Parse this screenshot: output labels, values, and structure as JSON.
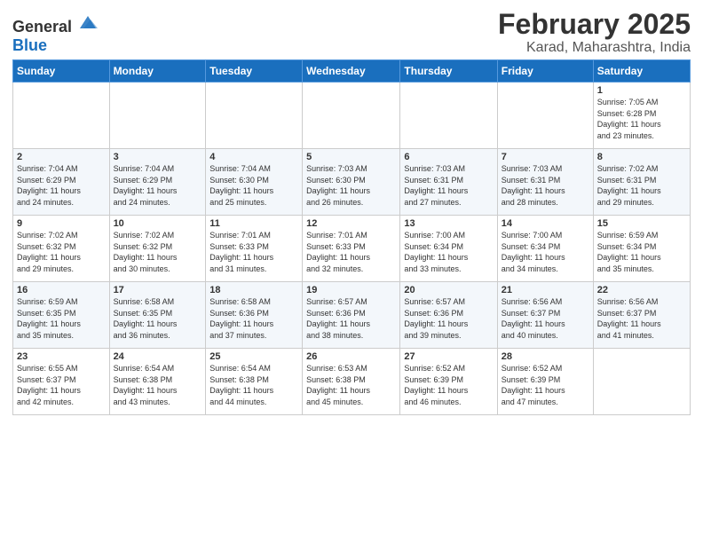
{
  "header": {
    "logo_general": "General",
    "logo_blue": "Blue",
    "month": "February 2025",
    "location": "Karad, Maharashtra, India"
  },
  "days_of_week": [
    "Sunday",
    "Monday",
    "Tuesday",
    "Wednesday",
    "Thursday",
    "Friday",
    "Saturday"
  ],
  "weeks": [
    [
      {
        "num": "",
        "info": ""
      },
      {
        "num": "",
        "info": ""
      },
      {
        "num": "",
        "info": ""
      },
      {
        "num": "",
        "info": ""
      },
      {
        "num": "",
        "info": ""
      },
      {
        "num": "",
        "info": ""
      },
      {
        "num": "1",
        "info": "Sunrise: 7:05 AM\nSunset: 6:28 PM\nDaylight: 11 hours\nand 23 minutes."
      }
    ],
    [
      {
        "num": "2",
        "info": "Sunrise: 7:04 AM\nSunset: 6:29 PM\nDaylight: 11 hours\nand 24 minutes."
      },
      {
        "num": "3",
        "info": "Sunrise: 7:04 AM\nSunset: 6:29 PM\nDaylight: 11 hours\nand 24 minutes."
      },
      {
        "num": "4",
        "info": "Sunrise: 7:04 AM\nSunset: 6:30 PM\nDaylight: 11 hours\nand 25 minutes."
      },
      {
        "num": "5",
        "info": "Sunrise: 7:03 AM\nSunset: 6:30 PM\nDaylight: 11 hours\nand 26 minutes."
      },
      {
        "num": "6",
        "info": "Sunrise: 7:03 AM\nSunset: 6:31 PM\nDaylight: 11 hours\nand 27 minutes."
      },
      {
        "num": "7",
        "info": "Sunrise: 7:03 AM\nSunset: 6:31 PM\nDaylight: 11 hours\nand 28 minutes."
      },
      {
        "num": "8",
        "info": "Sunrise: 7:02 AM\nSunset: 6:31 PM\nDaylight: 11 hours\nand 29 minutes."
      }
    ],
    [
      {
        "num": "9",
        "info": "Sunrise: 7:02 AM\nSunset: 6:32 PM\nDaylight: 11 hours\nand 29 minutes."
      },
      {
        "num": "10",
        "info": "Sunrise: 7:02 AM\nSunset: 6:32 PM\nDaylight: 11 hours\nand 30 minutes."
      },
      {
        "num": "11",
        "info": "Sunrise: 7:01 AM\nSunset: 6:33 PM\nDaylight: 11 hours\nand 31 minutes."
      },
      {
        "num": "12",
        "info": "Sunrise: 7:01 AM\nSunset: 6:33 PM\nDaylight: 11 hours\nand 32 minutes."
      },
      {
        "num": "13",
        "info": "Sunrise: 7:00 AM\nSunset: 6:34 PM\nDaylight: 11 hours\nand 33 minutes."
      },
      {
        "num": "14",
        "info": "Sunrise: 7:00 AM\nSunset: 6:34 PM\nDaylight: 11 hours\nand 34 minutes."
      },
      {
        "num": "15",
        "info": "Sunrise: 6:59 AM\nSunset: 6:34 PM\nDaylight: 11 hours\nand 35 minutes."
      }
    ],
    [
      {
        "num": "16",
        "info": "Sunrise: 6:59 AM\nSunset: 6:35 PM\nDaylight: 11 hours\nand 35 minutes."
      },
      {
        "num": "17",
        "info": "Sunrise: 6:58 AM\nSunset: 6:35 PM\nDaylight: 11 hours\nand 36 minutes."
      },
      {
        "num": "18",
        "info": "Sunrise: 6:58 AM\nSunset: 6:36 PM\nDaylight: 11 hours\nand 37 minutes."
      },
      {
        "num": "19",
        "info": "Sunrise: 6:57 AM\nSunset: 6:36 PM\nDaylight: 11 hours\nand 38 minutes."
      },
      {
        "num": "20",
        "info": "Sunrise: 6:57 AM\nSunset: 6:36 PM\nDaylight: 11 hours\nand 39 minutes."
      },
      {
        "num": "21",
        "info": "Sunrise: 6:56 AM\nSunset: 6:37 PM\nDaylight: 11 hours\nand 40 minutes."
      },
      {
        "num": "22",
        "info": "Sunrise: 6:56 AM\nSunset: 6:37 PM\nDaylight: 11 hours\nand 41 minutes."
      }
    ],
    [
      {
        "num": "23",
        "info": "Sunrise: 6:55 AM\nSunset: 6:37 PM\nDaylight: 11 hours\nand 42 minutes."
      },
      {
        "num": "24",
        "info": "Sunrise: 6:54 AM\nSunset: 6:38 PM\nDaylight: 11 hours\nand 43 minutes."
      },
      {
        "num": "25",
        "info": "Sunrise: 6:54 AM\nSunset: 6:38 PM\nDaylight: 11 hours\nand 44 minutes."
      },
      {
        "num": "26",
        "info": "Sunrise: 6:53 AM\nSunset: 6:38 PM\nDaylight: 11 hours\nand 45 minutes."
      },
      {
        "num": "27",
        "info": "Sunrise: 6:52 AM\nSunset: 6:39 PM\nDaylight: 11 hours\nand 46 minutes."
      },
      {
        "num": "28",
        "info": "Sunrise: 6:52 AM\nSunset: 6:39 PM\nDaylight: 11 hours\nand 47 minutes."
      },
      {
        "num": "",
        "info": ""
      }
    ]
  ]
}
